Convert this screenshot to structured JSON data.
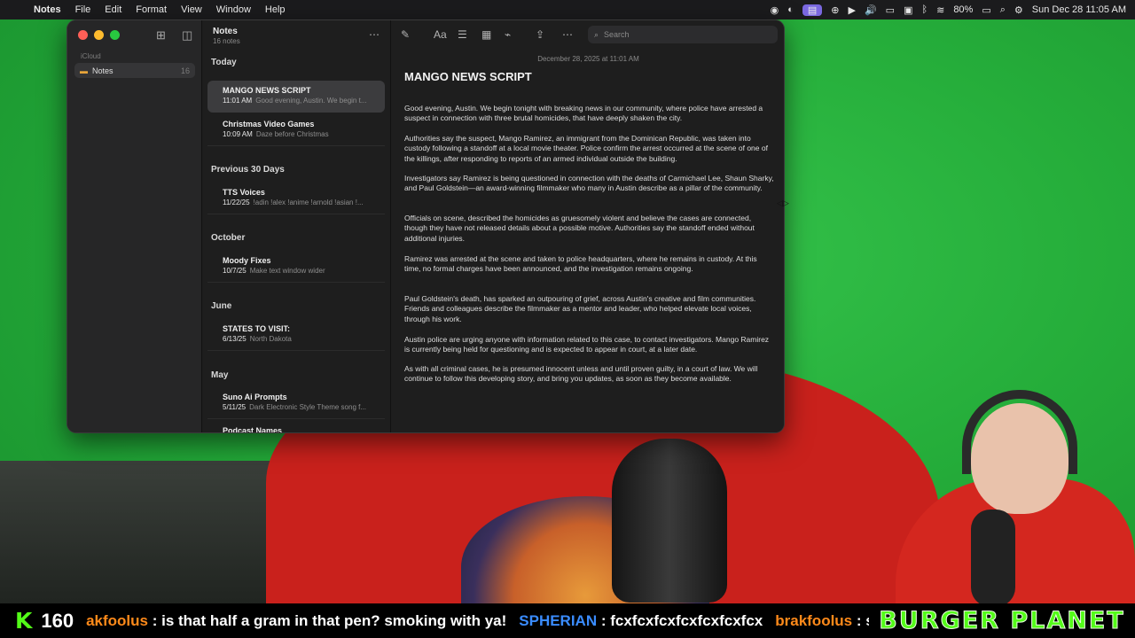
{
  "menubar": {
    "app": "Notes",
    "items": [
      "File",
      "Edit",
      "Format",
      "View",
      "Window",
      "Help"
    ],
    "battery": "80%",
    "datetime": "Sun Dec 28  11:05 AM"
  },
  "sidebar": {
    "section": "iCloud",
    "folder": {
      "label": "Notes",
      "count": "16"
    }
  },
  "list": {
    "title": "Notes",
    "subtitle": "16 notes",
    "groups": [
      {
        "label": "Today"
      },
      {
        "label": "Previous 30 Days"
      },
      {
        "label": "October"
      },
      {
        "label": "June"
      },
      {
        "label": "May"
      }
    ],
    "notes": [
      {
        "title": "MANGO NEWS SCRIPT",
        "time": "11:01 AM",
        "preview": "Good evening, Austin. We begin t..."
      },
      {
        "title": "Christmas Video Games",
        "time": "10:09 AM",
        "preview": "Daze before Christmas"
      },
      {
        "title": "TTS Voices",
        "time": "11/22/25",
        "preview": "!adin !alex !anime !arnold !asian !..."
      },
      {
        "title": "Moody Fixes",
        "time": "10/7/25",
        "preview": "Make text window wider"
      },
      {
        "title": "STATES TO VISIT:",
        "time": "6/13/25",
        "preview": "North Dakota"
      },
      {
        "title": "Suno Ai Prompts",
        "time": "5/11/25",
        "preview": "Dark Electronic Style Theme song f..."
      },
      {
        "title": "Podcast Names",
        "time": "",
        "preview": ""
      }
    ]
  },
  "editor": {
    "search_placeholder": "Search",
    "date": "December 28, 2025 at 11:01 AM",
    "heading": "MANGO NEWS SCRIPT",
    "paragraphs": [
      "Good evening, Austin. We begin tonight with breaking news in our community, where police have arrested a suspect in connection with three brutal homicides, that have deeply shaken the city.",
      "Authorities say the suspect, Mango Ramirez, an immigrant from the Dominican Republic, was taken into custody following a standoff at a local movie theater. Police confirm the arrest occurred at the scene of one of the killings, after responding to reports of an armed individual outside the building.",
      "Investigators say Ramirez is being questioned in connection with the deaths of Carmichael Lee, Shaun Sharky, and Paul Goldstein—an award-winning filmmaker who many in Austin describe as a pillar of the community.",
      "Officials on scene, described the homicides as gruesomely violent and believe the cases are connected, though they have not released details about a possible motive. Authorities say the standoff ended without additional injuries.",
      "Ramirez was arrested at the scene and taken to police headquarters, where he remains in custody. At this time, no formal charges have been announced, and the investigation remains ongoing.",
      "Paul Goldstein's death, has sparked an outpouring of grief, across Austin's creative and film communities. Friends and colleagues describe the filmmaker as a mentor and leader, who helped elevate local voices, through his work.",
      "Austin police are urging anyone with information related to this case, to contact investigators. Mango Ramirez is currently being held for questioning and is expected to appear in court, at a later date.",
      "As with all criminal cases, he is presumed innocent unless and until proven guilty, in a court of law. We will continue to follow this developing story, and bring you updates, as soon as they become available."
    ]
  },
  "overlay": {
    "viewer_count": "160",
    "messages": [
      {
        "user": "akfoolus",
        "text": " : is that half a gram in that pen? smoking with ya!"
      },
      {
        "user": "SPHERIAN",
        "text": " : fcxfcxfcxfcxfcxfcxfcx"
      },
      {
        "user": "brakfoolus",
        "text": " : score!"
      }
    ],
    "brand": "BURGER PLANET"
  }
}
